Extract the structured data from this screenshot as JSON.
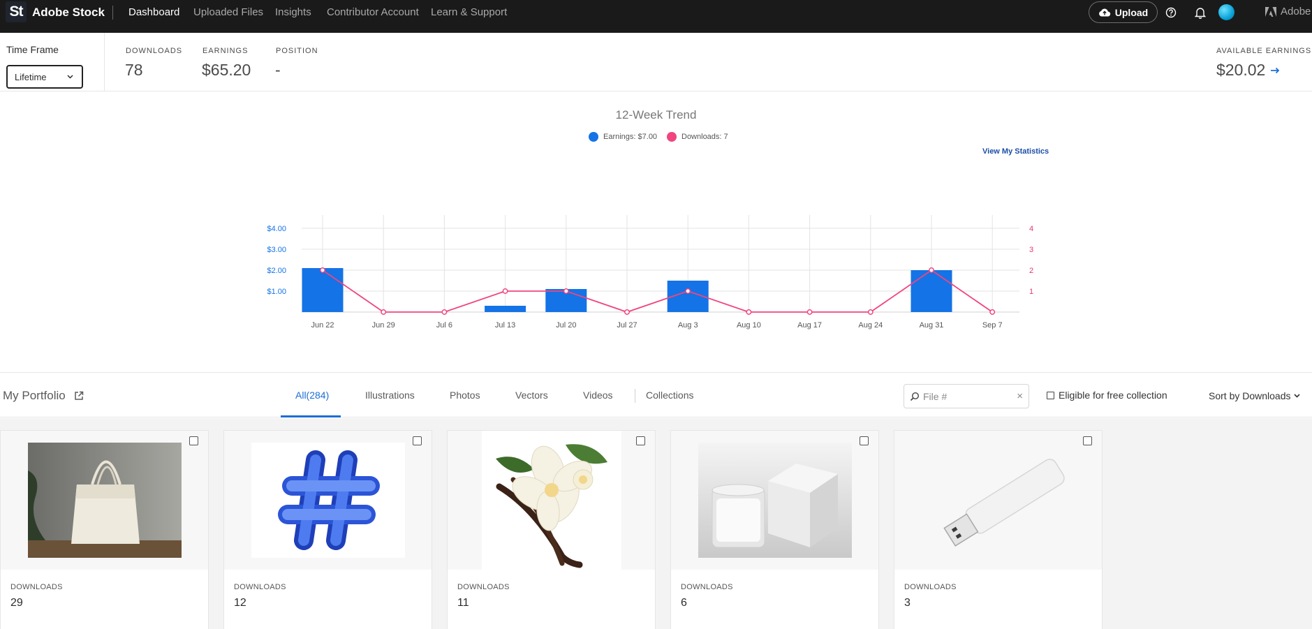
{
  "app": {
    "logo_letters": "St",
    "name": "Adobe Stock"
  },
  "nav": {
    "items": [
      {
        "label": "Dashboard",
        "active": true
      },
      {
        "label": "Uploaded Files"
      },
      {
        "label": "Insights"
      },
      {
        "label": "Contributor Account"
      },
      {
        "label": "Learn & Support"
      }
    ],
    "upload_label": "Upload",
    "adobe_label": "Adobe"
  },
  "stats": {
    "timeframe_label": "Time Frame",
    "timeframe_value": "Lifetime",
    "downloads_label": "DOWNLOADS",
    "downloads_value": "78",
    "earnings_label": "EARNINGS",
    "earnings_value": "$65.20",
    "position_label": "POSITION",
    "position_value": "-",
    "available_label": "AVAILABLE EARNINGS",
    "available_value": "$20.02"
  },
  "trend": {
    "title": "12-Week Trend",
    "legend_earnings": "Earnings: $7.00",
    "legend_downloads": "Downloads: 7",
    "view_stats_label": "View My Statistics"
  },
  "chart_data": {
    "type": "bar",
    "title": "12-Week Trend",
    "categories": [
      "Jun 22",
      "Jun 29",
      "Jul 6",
      "Jul 13",
      "Jul 20",
      "Jul 27",
      "Aug 3",
      "Aug 10",
      "Aug 17",
      "Aug 24",
      "Aug 31",
      "Sep 7"
    ],
    "series": [
      {
        "name": "Earnings: $7.00",
        "type": "bar",
        "axis": "left",
        "color": "#1473e6",
        "values": [
          2.1,
          0,
          0,
          0.3,
          1.1,
          0,
          1.5,
          0,
          0,
          0,
          2.0,
          0
        ]
      },
      {
        "name": "Downloads: 7",
        "type": "line",
        "axis": "right",
        "color": "#f0457e",
        "values": [
          2,
          0,
          0,
          1,
          1,
          0,
          1,
          0,
          0,
          0,
          2,
          0
        ]
      }
    ],
    "y_left": {
      "ticks": [
        "$1.00",
        "$2.00",
        "$3.00",
        "$4.00"
      ],
      "tick_values": [
        1,
        2,
        3,
        4
      ],
      "range": [
        0,
        4
      ]
    },
    "y_right": {
      "ticks": [
        "1",
        "2",
        "3",
        "4"
      ],
      "tick_values": [
        1,
        2,
        3,
        4
      ],
      "range": [
        0,
        4
      ]
    },
    "grid": true
  },
  "portfolio": {
    "title": "My Portfolio",
    "tabs": [
      {
        "label": "All(284)",
        "active": true
      },
      {
        "label": "Illustrations"
      },
      {
        "label": "Photos"
      },
      {
        "label": "Vectors"
      },
      {
        "label": "Videos"
      },
      {
        "label": "Collections"
      }
    ],
    "search_placeholder": "File #",
    "eligible_label": "Eligible for free collection",
    "sort_label": "Sort by Downloads",
    "cards": [
      {
        "downloads_label": "DOWNLOADS",
        "downloads": "29",
        "icon": "tote-bag-image"
      },
      {
        "downloads_label": "DOWNLOADS",
        "downloads": "12",
        "icon": "hashtag-image"
      },
      {
        "downloads_label": "DOWNLOADS",
        "downloads": "11",
        "icon": "vanilla-flower-image"
      },
      {
        "downloads_label": "DOWNLOADS",
        "downloads": "6",
        "icon": "candle-box-image"
      },
      {
        "downloads_label": "DOWNLOADS",
        "downloads": "3",
        "icon": "usb-drive-image"
      }
    ]
  }
}
